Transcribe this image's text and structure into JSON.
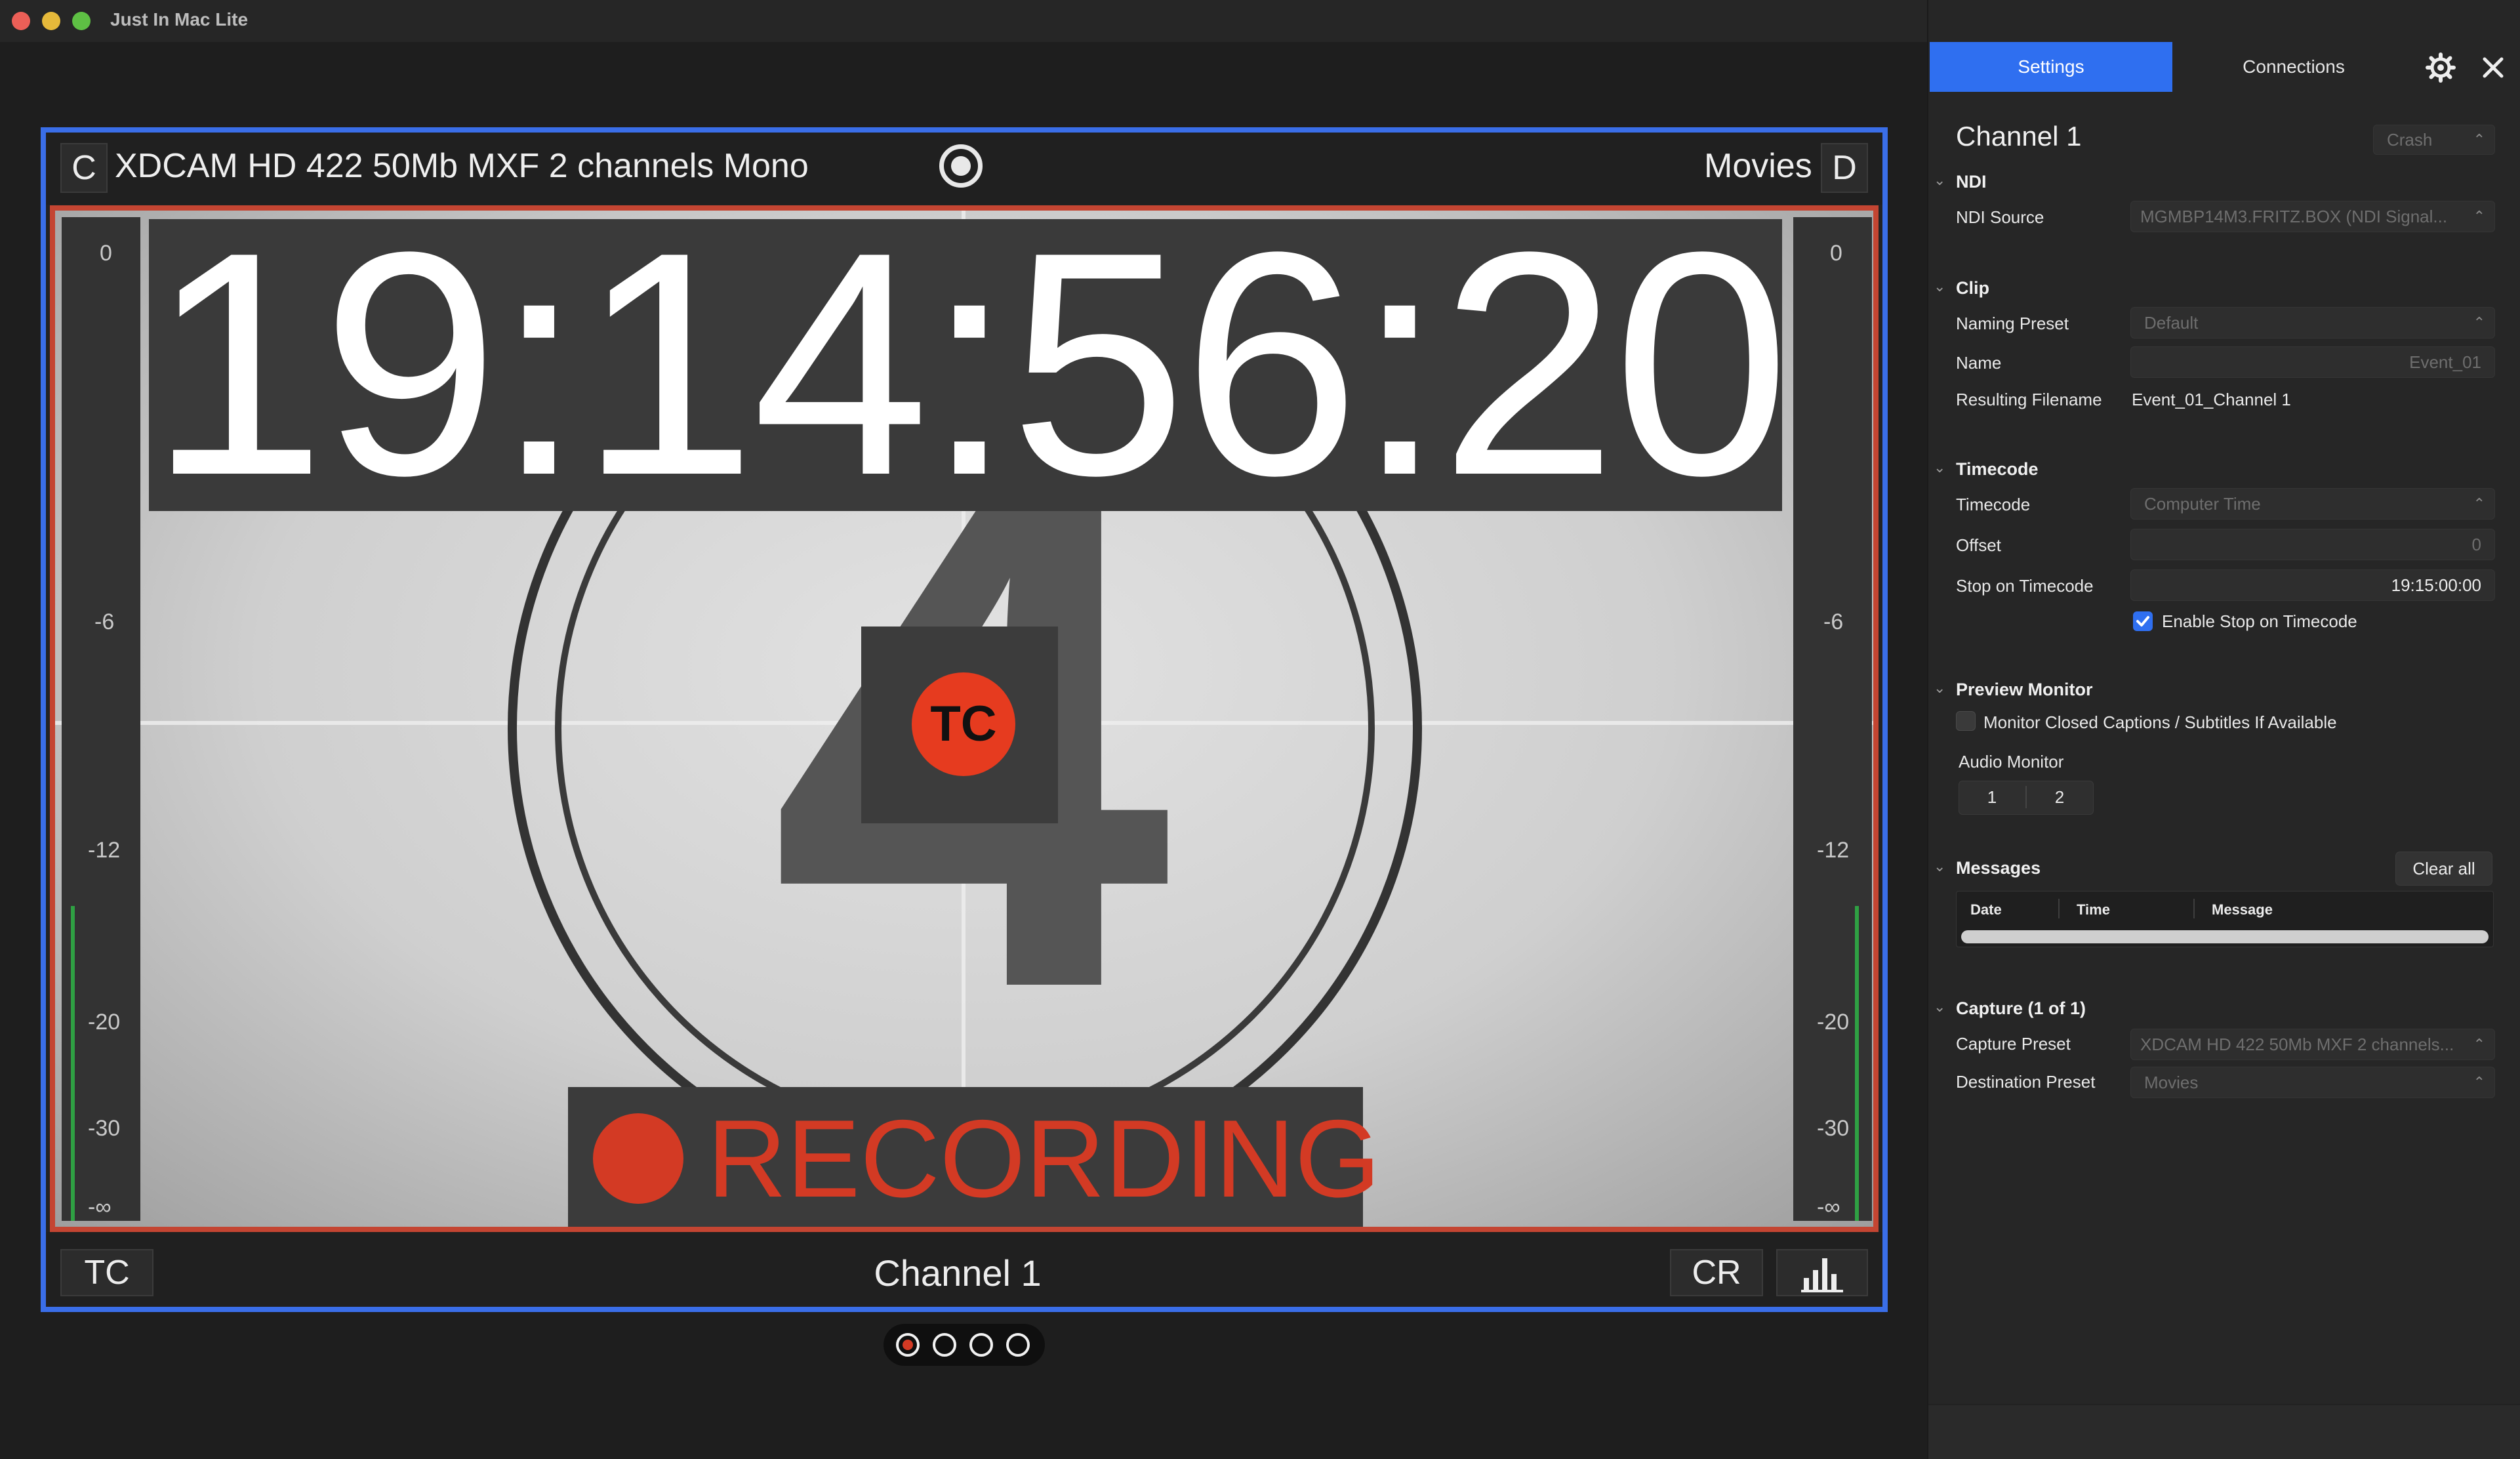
{
  "window": {
    "title": "Just In Mac Lite"
  },
  "monitor": {
    "left_letter": "C",
    "format": "XDCAM HD 422 50Mb MXF 2 channels Mono",
    "destination": "Movies",
    "right_letter": "D",
    "timecode": "19:14:56:20",
    "countdown_number": "4",
    "tc_badge": "TC",
    "recording_label": "RECORDING",
    "meter_ticks": [
      "0",
      "-6",
      "-12",
      "-20",
      "-30",
      "-∞"
    ],
    "bottom_left": "TC",
    "channel_name": "Channel 1",
    "bottom_right": "CR"
  },
  "pager": {
    "active_index": 0,
    "count": 4
  },
  "panel": {
    "tabs": {
      "settings": "Settings",
      "connections": "Connections"
    },
    "channel_title": "Channel 1",
    "channel_preset": "Crash",
    "ndi": {
      "section": "NDI",
      "source_label": "NDI Source",
      "source_value": "MGMBP14M3.FRITZ.BOX (NDI Signal..."
    },
    "clip": {
      "section": "Clip",
      "naming_preset_label": "Naming Preset",
      "naming_preset_value": "Default",
      "name_label": "Name",
      "name_value": "Event_01",
      "filename_label": "Resulting Filename",
      "filename_value": "Event_01_Channel 1"
    },
    "timecode": {
      "section": "Timecode",
      "timecode_label": "Timecode",
      "timecode_value": "Computer Time",
      "offset_label": "Offset",
      "offset_value": "0",
      "stop_label": "Stop on Timecode",
      "stop_value": "19:15:00:00",
      "enable_stop_label": "Enable Stop on Timecode",
      "enable_stop_checked": true
    },
    "preview": {
      "section": "Preview Monitor",
      "captions_label": "Monitor Closed Captions / Subtitles If Available",
      "captions_checked": false,
      "audio_monitor_label": "Audio Monitor",
      "audio_channels": [
        "1",
        "2"
      ]
    },
    "messages": {
      "section": "Messages",
      "clear_label": "Clear all",
      "columns": [
        "Date",
        "Time",
        "Message"
      ]
    },
    "capture": {
      "section": "Capture (1 of 1)",
      "capture_preset_label": "Capture Preset",
      "capture_preset_value": "XDCAM HD 422 50Mb MXF 2 channels...",
      "destination_preset_label": "Destination Preset",
      "destination_preset_value": "Movies"
    }
  },
  "colors": {
    "frame_blue": "#3a6ee8",
    "record_red": "#d33a24",
    "tab_active": "#2f6ff0",
    "checkbox_blue": "#2f6ff0",
    "meter_green": "#2fa043"
  },
  "icons": {
    "record": "record-icon",
    "gear": "gear-icon",
    "close": "close-icon",
    "audio_meter": "bar-chart-icon",
    "chevron": "chevron-down-icon",
    "select": "updown-arrows-icon"
  }
}
